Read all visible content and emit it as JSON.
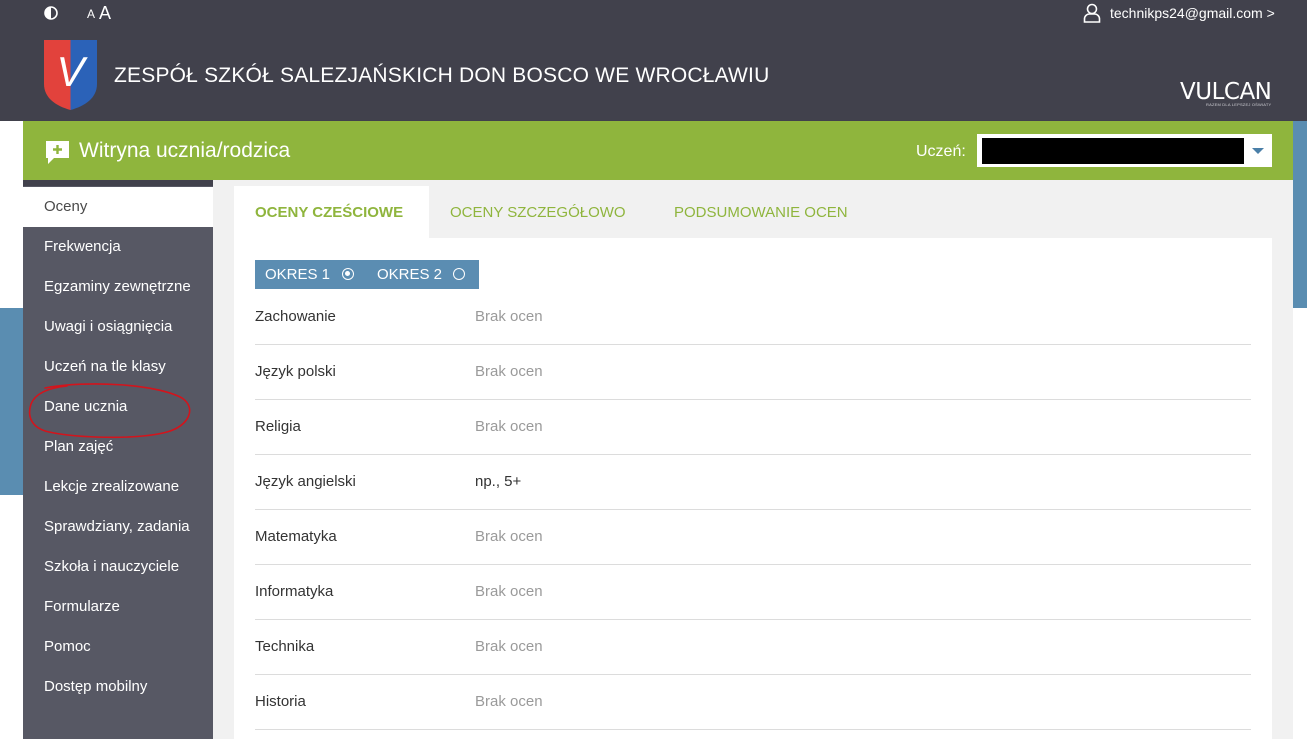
{
  "topbar": {
    "font_small": "A",
    "font_large": "A",
    "user_email": "technikps24@gmail.com >",
    "school_name": "ZESPÓŁ SZKÓŁ SALEZJAŃSKICH DON BOSCO WE WROCŁAWIU",
    "vendor_logo": "VULCAN",
    "vendor_tagline": "RAZEM DLA LEPSZEJ OŚWIATY",
    "logo_letter": "V"
  },
  "portal": {
    "title": "Witryna ucznia/rodzica",
    "student_label": "Uczeń:",
    "student_value": ""
  },
  "sidebar": {
    "items": [
      {
        "label": "Oceny",
        "active": true
      },
      {
        "label": "Frekwencja"
      },
      {
        "label": "Egzaminy zewnętrzne"
      },
      {
        "label": "Uwagi i osiągnięcia"
      },
      {
        "label": "Uczeń na tle klasy"
      },
      {
        "label": "Dane ucznia"
      },
      {
        "label": "Plan zajęć"
      },
      {
        "label": "Lekcje zrealizowane"
      },
      {
        "label": "Sprawdziany, zadania"
      },
      {
        "label": "Szkoła i nauczyciele"
      },
      {
        "label": "Formularze"
      },
      {
        "label": "Pomoc"
      },
      {
        "label": "Dostęp mobilny"
      }
    ]
  },
  "tabs": [
    {
      "label": "OCENY CZEŚCIOWE",
      "active": true
    },
    {
      "label": "OCENY SZCZEGÓŁOWO"
    },
    {
      "label": "PODSUMOWANIE OCEN"
    }
  ],
  "periods": [
    {
      "label": "OKRES 1",
      "selected": true
    },
    {
      "label": "OKRES 2",
      "selected": false
    }
  ],
  "subjects": [
    {
      "name": "Zachowanie",
      "grades": "Brak ocen"
    },
    {
      "name": "Język polski",
      "grades": "Brak ocen"
    },
    {
      "name": "Religia",
      "grades": "Brak ocen"
    },
    {
      "name": "Język angielski",
      "grades": "np., 5+"
    },
    {
      "name": "Matematyka",
      "grades": "Brak ocen"
    },
    {
      "name": "Informatyka",
      "grades": "Brak ocen"
    },
    {
      "name": "Technika",
      "grades": "Brak ocen"
    },
    {
      "name": "Historia",
      "grades": "Brak ocen"
    }
  ],
  "icons": [
    "contrast-icon",
    "user-icon",
    "chat-add-icon",
    "chevron-down-icon",
    "radio-icon"
  ],
  "colors": {
    "header_bg": "#41414c",
    "green_accent": "#8fb53d",
    "sidebar_bg": "#575864",
    "blue_accent": "#5b8db2",
    "annotation_red": "#d3141c"
  }
}
